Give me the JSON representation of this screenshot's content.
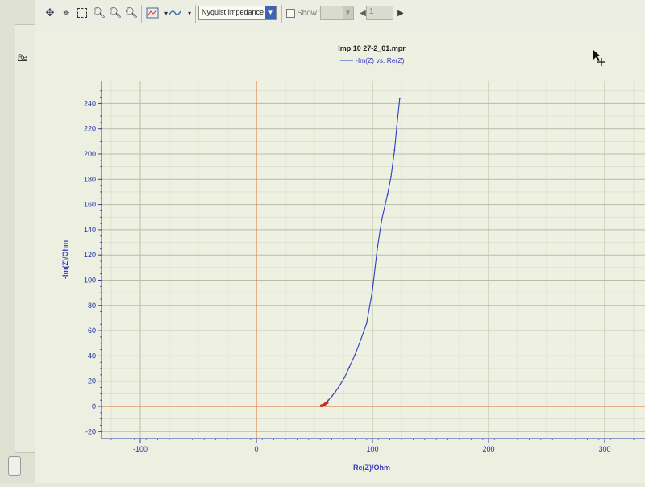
{
  "toolbar": {
    "icons": [
      "move-icon",
      "select-point-icon",
      "zoom-box-icon",
      "zoom-in-icon",
      "zoom-out-icon",
      "zoom-reset-icon",
      "graph-style-icon",
      "curve-fit-icon"
    ],
    "graph_type_select": "Nyquist Impedance",
    "show_label": "Show :",
    "show_select": "",
    "cycle_value": "1"
  },
  "sidebar": {
    "tab_label": "Re"
  },
  "chart_data": {
    "type": "line",
    "title": "Imp 10 27-2_01.mpr",
    "legend": [
      "-Im(Z) vs. Re(Z)"
    ],
    "legend_placement": "top-center",
    "xlabel": "Re(Z)/Ohm",
    "ylabel": "-Im(Z)/Ohm",
    "xlim": [
      -135,
      330
    ],
    "ylim": [
      -25,
      250
    ],
    "xticks": [
      -100,
      0,
      100,
      200,
      300
    ],
    "yticks": [
      -20,
      0,
      20,
      40,
      60,
      80,
      100,
      120,
      140,
      160,
      180,
      200,
      220,
      240
    ],
    "grid": true,
    "series": [
      {
        "name": "-Im(Z) vs. Re(Z)",
        "color": "#2e3cc8",
        "x": [
          56.5,
          58,
          60,
          62,
          65,
          68,
          72,
          76,
          80,
          85,
          90,
          95,
          100,
          104,
          108,
          113,
          116,
          119,
          121,
          123.5
        ],
        "y": [
          0.5,
          1.5,
          3,
          5,
          8,
          11.5,
          17,
          23,
          31,
          41,
          53,
          66,
          92,
          124,
          148,
          168,
          182,
          203,
          222,
          244
        ]
      }
    ],
    "markers": {
      "color": "#c8281e",
      "x": [
        56,
        57,
        58,
        59,
        60,
        61
      ],
      "y": [
        0.5,
        0.8,
        1.2,
        1.8,
        2.5,
        3.2
      ]
    }
  }
}
